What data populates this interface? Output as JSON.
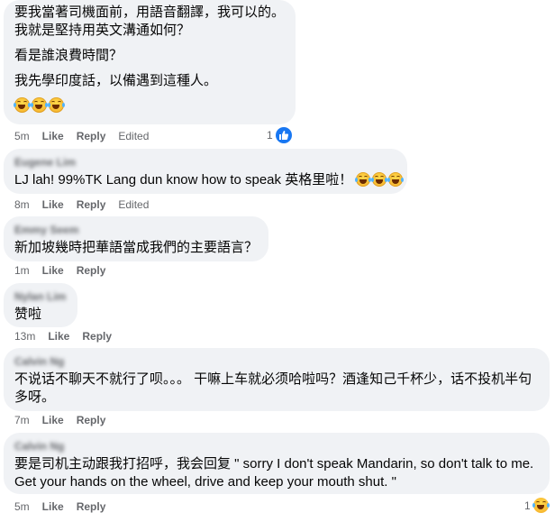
{
  "comments": [
    {
      "author": "",
      "lines": [
        "要我當著司機面前，用語音翻譯，我可以的。",
        "我就是堅持用英文溝通如何？",
        "看是誰浪費時間？",
        "我先學印度話，以備遇到這種人。"
      ],
      "emojis": [
        "laughing-tears",
        "laughing-tears",
        "laughing-tears"
      ],
      "time": "5m",
      "like": "Like",
      "reply": "Reply",
      "edited": "Edited",
      "reaction_count": "1",
      "reaction_type": "like"
    },
    {
      "author": "Eugene Lim",
      "text": "LJ lah! 99%TK Lang dun know how to speak 英格里啦！",
      "emojis": [
        "laughing-tears",
        "laughing-tears",
        "laughing-tears"
      ],
      "time": "8m",
      "like": "Like",
      "reply": "Reply",
      "edited": "Edited"
    },
    {
      "author": "Emmy Seem",
      "text": "新加坡幾時把華語當成我們的主要語言？",
      "time": "1m",
      "like": "Like",
      "reply": "Reply"
    },
    {
      "author": "Nylan Lim",
      "text": "赞啦",
      "time": "13m",
      "like": "Like",
      "reply": "Reply"
    },
    {
      "author": "Calvin Ng",
      "lines": [
        "不说话不聊天不就行了呗。。。 干嘛上车就必须哈啦吗？酒逢知己千杯少，话不投机半句",
        "多呀。"
      ],
      "time": "7m",
      "like": "Like",
      "reply": "Reply"
    },
    {
      "author": "Calvin Ng",
      "lines": [
        "要是司机主动跟我打招呼，我会回复 \" sorry I don't speak Mandarin, so don't talk to me.",
        "Get your hands on the wheel, drive and keep your mouth shut. \""
      ],
      "time": "5m",
      "like": "Like",
      "reply": "Reply",
      "reaction_count": "1",
      "reaction_type": "haha"
    }
  ],
  "colors": {
    "bubble": "#f0f2f5",
    "meta": "#65676b",
    "text": "#050505",
    "like_blue": "#1877f2"
  }
}
